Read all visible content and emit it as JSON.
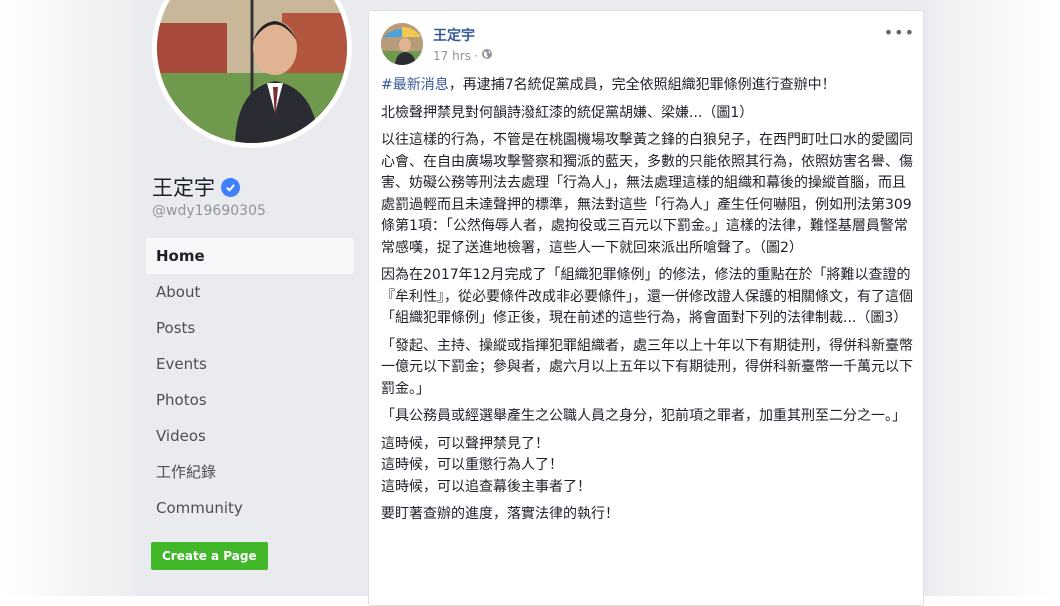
{
  "page": {
    "name": "王定宇",
    "handle": "@wdy19690305"
  },
  "nav": {
    "items": [
      "Home",
      "About",
      "Posts",
      "Events",
      "Photos",
      "Videos",
      "工作紀錄",
      "Community"
    ],
    "create_page": "Create a Page"
  },
  "post": {
    "author": "王定宇",
    "time": "17 hrs",
    "more": "•••",
    "hashtag": "#最新消息",
    "p1_rest": "，再逮捕7名統促黨成員，完全依照組織犯罪條例進行查辦中！",
    "p2": "北檢聲押禁見對何韻詩潑紅漆的統促黨胡嫌、梁嫌...（圖1）",
    "p3": "以往這樣的行為，不管是在桃園機場攻擊黃之鋒的白狼兒子，在西門町吐口水的愛國同心會、在自由廣場攻擊警察和獨派的藍天，多數的只能依照其行為，依照妨害名譽、傷害、妨礙公務等刑法去處理「行為人」，無法處理這樣的組織和幕後的操縱首腦，而且處罰過輕而且未達聲押的標準，無法對這些「行為人」產生任何嚇阻，例如刑法第309條第1項：「公然侮辱人者，處拘役或三百元以下罰金。」這樣的法律，難怪基層員警常常感嘆，捉了送進地檢署，這些人一下就回來派出所嗆聲了。（圖2）",
    "p4": "因為在2017年12月完成了「組織犯罪條例」的修法，修法的重點在於「將難以查證的『牟利性』，從必要條件改成非必要條件」，還一併修改證人保護的相關條文，有了這個「組織犯罪條例」修正後，現在前述的這些行為，將會面對下列的法律制裁...（圖3）",
    "p5": "「發起、主持、操縱或指揮犯罪組織者，處三年以上十年以下有期徒刑，得併科新臺幣一億元以下罰金；參與者，處六月以上五年以下有期徒刑，得併科新臺幣一千萬元以下罰金。」",
    "p6": "「具公務員或經選舉產生之公職人員之身分，犯前項之罪者，加重其刑至二分之一。」",
    "l1": "這時候，可以聲押禁見了！",
    "l2": "這時候，可以重懲行為人了！",
    "l3": "這時候，可以追查幕後主事者了！",
    "p8": "要盯著查辦的進度，落實法律的執行！"
  },
  "colors": {
    "link": "#365899",
    "verified": "#4080ff",
    "create_button": "#42b72a",
    "background": "#e9ebee"
  },
  "icons": [
    "verified-badge-icon",
    "globe-icon",
    "more-options-icon"
  ]
}
